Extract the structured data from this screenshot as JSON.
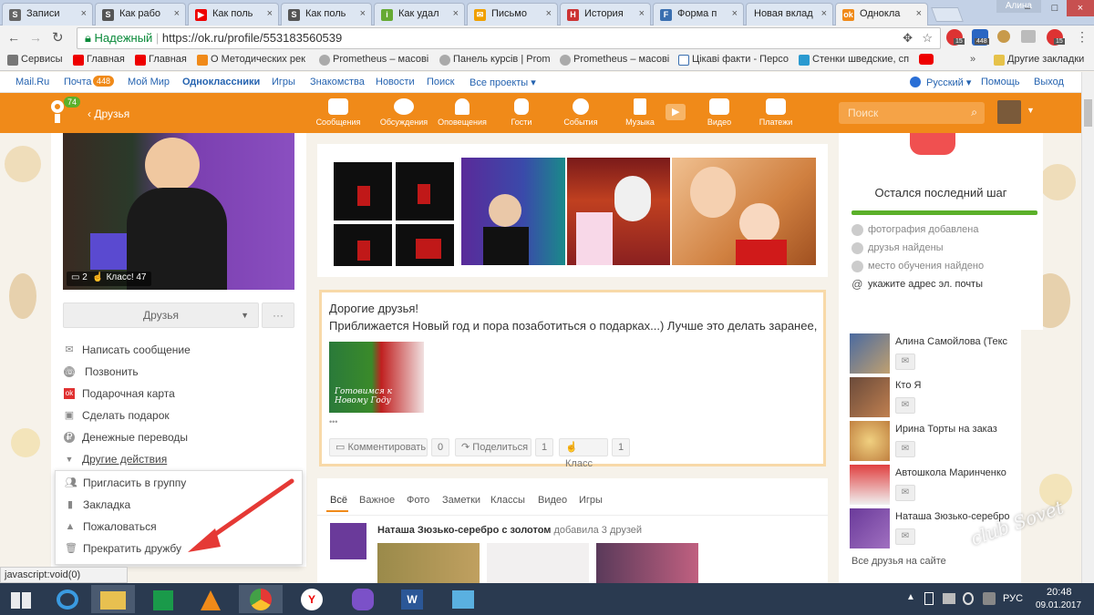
{
  "browser": {
    "tabs": [
      {
        "label": "Записи",
        "color": "#666"
      },
      {
        "label": "Как рабо",
        "color": "#555"
      },
      {
        "label": "Как поль",
        "color": "#e00"
      },
      {
        "label": "Как поль",
        "color": "#555"
      },
      {
        "label": "Как удал",
        "color": "#6a3"
      },
      {
        "label": "Письмо",
        "color": "#f0a000"
      },
      {
        "label": "История",
        "color": "#c33"
      },
      {
        "label": "Форма п",
        "color": "#3a6fb0"
      },
      {
        "label": "Новая вклад",
        "color": "#bbb"
      },
      {
        "label": "Однокла",
        "color": "#f08a19"
      }
    ],
    "user": "Алина",
    "secure_label": "Надежный",
    "url": "https://ok.ru/profile/553183560539",
    "bookmarks": [
      {
        "label": "Сервисы",
        "color": "#777"
      },
      {
        "label": "Главная",
        "color": "#e00"
      },
      {
        "label": "Главная",
        "color": "#e00"
      },
      {
        "label": "О Методических рек",
        "color": "#f08a19"
      },
      {
        "label": "Prometheus – масові",
        "color": "#aaa"
      },
      {
        "label": "Панель курсів | Prom",
        "color": "#aaa"
      },
      {
        "label": "Prometheus – масові",
        "color": "#aaa"
      },
      {
        "label": "Цікаві факти - Персо",
        "color": "#3a6fb0"
      },
      {
        "label": "Стенки шведские, сп",
        "color": "#2a9ad0"
      },
      {
        "label": "Другие закладки",
        "color": "#e6c24a"
      }
    ],
    "ext_badges": [
      "15",
      "448",
      "15"
    ],
    "status_text": "javascript:void(0)"
  },
  "mailbar": {
    "links": [
      "Mail.Ru",
      "Почта",
      "Мой Мир",
      "Одноклассники",
      "Игры",
      "Знакомства",
      "Новости",
      "Поиск",
      "Все проекты ▾"
    ],
    "mail_count": "448",
    "language": "Русский ▾",
    "help": "Помощь",
    "logout": "Выход"
  },
  "okbar": {
    "logo_badge": "74",
    "breadcrumb": "‹ Друзья",
    "nav": [
      "Сообщения",
      "Обсуждения",
      "Оповещения",
      "Гости",
      "События",
      "Музыка",
      "",
      "Видео",
      "Платежи"
    ],
    "search_placeholder": "Поиск"
  },
  "profile": {
    "comments": "2",
    "likes": "Класс! 47",
    "friends_button": "Друзья",
    "more_button": "···",
    "actions": [
      "Написать сообщение",
      "Позвонить",
      "Подарочная карта",
      "Сделать подарок",
      "Денежные переводы"
    ],
    "other_actions": "Другие действия",
    "dropdown": [
      "Пригласить в группу",
      "Закладка",
      "Пожаловаться",
      "Прекратить дружбу"
    ]
  },
  "post": {
    "line1": "Дорогие друзья!",
    "line2": "Приближается Новый год и пора позаботиться о подарках...) Лучше это делать заранее,",
    "thumb_caption": "Готовимся к Новому Году",
    "ellipsis": "•••",
    "comment_label": "Комментировать",
    "comment_count": "0",
    "share_label": "Поделиться",
    "share_count": "1",
    "like_label": "Класс",
    "like_count": "1"
  },
  "feed": {
    "tabs": [
      "Всё",
      "Важное",
      "Фото",
      "Заметки",
      "Классы",
      "Видео",
      "Игры"
    ],
    "author": "Наташа Зюзько-серебро с золотом",
    "action": "добавила 3 друзей"
  },
  "sidebar": {
    "title": "Остался последний шаг",
    "steps": [
      "фотография добавлена",
      "друзья найдены",
      "место обучения найдено",
      "укажите адрес эл. почты"
    ],
    "friends": [
      "Алина Самойлова (Текс",
      "Кто Я",
      "Ирина Торты на заказ",
      "Автошкола Маринченко",
      "Наташа Зюзько-серебро"
    ],
    "all_friends": "Все друзья на сайте",
    "watermark": "club Sovet"
  },
  "taskbar": {
    "lang": "РУС",
    "time": "20:48",
    "date": "09.01.2017"
  },
  "colors": {
    "ok_orange": "#f08a19",
    "link_blue": "#2563b0",
    "arrow_red": "#e53935"
  }
}
